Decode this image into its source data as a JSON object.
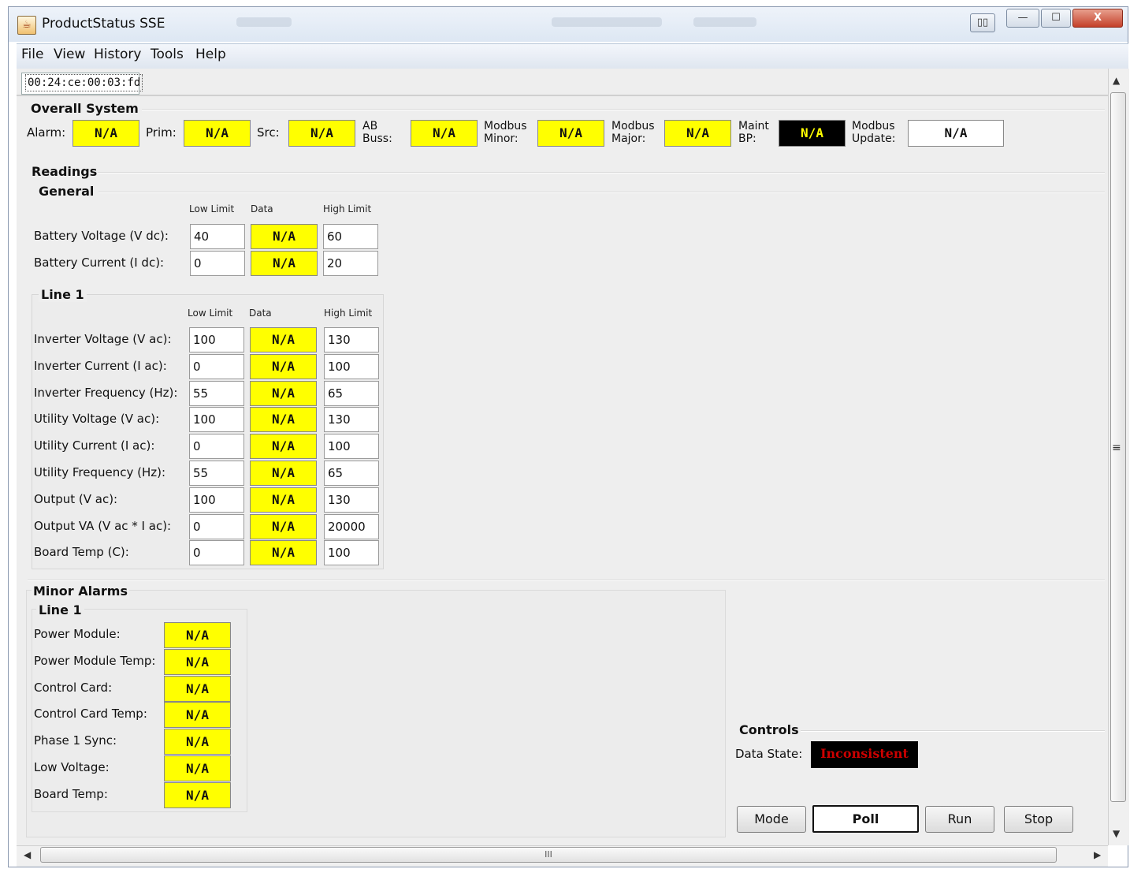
{
  "window": {
    "title": "ProductStatus SSE",
    "controls": {
      "minimize": "—",
      "maximize": "☐",
      "close": "X"
    }
  },
  "menu": [
    "File",
    "View",
    "History",
    "Tools",
    "Help"
  ],
  "tab": "00:24:ce:00:03:fd",
  "overall": {
    "header": "Overall System",
    "items": [
      {
        "label": "Alarm:",
        "value": "N/A"
      },
      {
        "label": "Prim:",
        "value": "N/A"
      },
      {
        "label": "Src:",
        "value": "N/A"
      },
      {
        "label1": "AB",
        "label2": "Buss:",
        "value": "N/A"
      },
      {
        "label1": "Modbus",
        "label2": "Minor:",
        "value": "N/A"
      },
      {
        "label1": "Modbus",
        "label2": "Major:",
        "value": "N/A"
      },
      {
        "label1": "Maint",
        "label2": "BP:",
        "value": "N/A"
      },
      {
        "label1": "Modbus",
        "label2": "Update:",
        "value": "N/A"
      }
    ]
  },
  "readings": {
    "header": "Readings",
    "general": {
      "header": "General",
      "col_low": "Low Limit",
      "col_data": "Data",
      "col_high": "High Limit",
      "rows": [
        {
          "label": "Battery Voltage (V dc):",
          "low": "40",
          "data": "N/A",
          "high": "60"
        },
        {
          "label": "Battery Current (I dc):",
          "low": "0",
          "data": "N/A",
          "high": "20"
        }
      ]
    },
    "line1": {
      "header": "Line 1",
      "col_low": "Low Limit",
      "col_data": "Data",
      "col_high": "High Limit",
      "rows": [
        {
          "label": "Inverter Voltage (V ac):",
          "low": "100",
          "data": "N/A",
          "high": "130"
        },
        {
          "label": "Inverter Current (I ac):",
          "low": "0",
          "data": "N/A",
          "high": "100"
        },
        {
          "label": "Inverter Frequency (Hz):",
          "low": "55",
          "data": "N/A",
          "high": "65"
        },
        {
          "label": "Utility Voltage (V ac):",
          "low": "100",
          "data": "N/A",
          "high": "130"
        },
        {
          "label": "Utility Current (I ac):",
          "low": "0",
          "data": "N/A",
          "high": "100"
        },
        {
          "label": "Utility Frequency (Hz):",
          "low": "55",
          "data": "N/A",
          "high": "65"
        },
        {
          "label": "Output (V ac):",
          "low": "100",
          "data": "N/A",
          "high": "130"
        },
        {
          "label": "Output VA (V ac * I ac):",
          "low": "0",
          "data": "N/A",
          "high": "20000"
        },
        {
          "label": "Board Temp (C):",
          "low": "0",
          "data": "N/A",
          "high": "100"
        }
      ]
    }
  },
  "minor_alarms": {
    "header": "Minor Alarms",
    "line_header": "Line 1",
    "rows": [
      {
        "label": "Power Module:",
        "value": "N/A"
      },
      {
        "label": "Power Module Temp:",
        "value": "N/A"
      },
      {
        "label": "Control Card:",
        "value": "N/A"
      },
      {
        "label": "Control Card Temp:",
        "value": "N/A"
      },
      {
        "label": "Phase 1 Sync:",
        "value": "N/A"
      },
      {
        "label": "Low Voltage:",
        "value": "N/A"
      },
      {
        "label": "Board Temp:",
        "value": "N/A"
      }
    ]
  },
  "controls": {
    "header": "Controls",
    "state_label": "Data State:",
    "state_value": "Inconsistent",
    "buttons": {
      "mode": "Mode",
      "poll": "Poll",
      "run": "Run",
      "stop": "Stop"
    }
  },
  "scroll": {
    "h_grip": "III",
    "v_grip": "≡",
    "up": "▲",
    "down": "▼",
    "left": "◀",
    "right": "▶"
  },
  "colors": {
    "alarm_yellow": "#ffff00",
    "alarm_black": "#000000",
    "state_red": "#cc0000"
  }
}
